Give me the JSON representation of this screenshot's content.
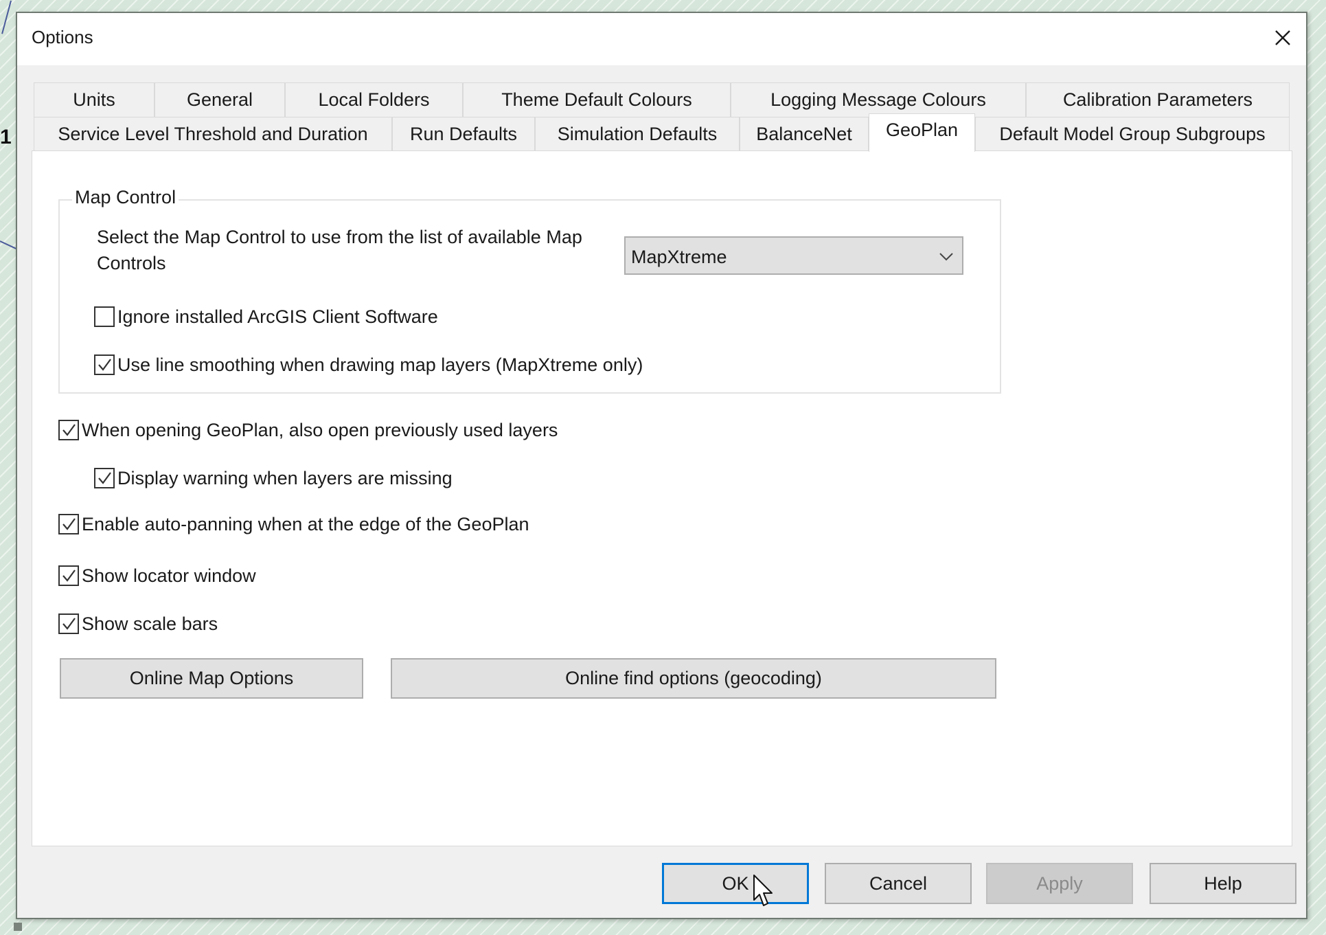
{
  "background": {
    "partial_label": "1"
  },
  "dialog": {
    "title": "Options",
    "close_icon": "close-icon",
    "tabs_row1": [
      {
        "label": "Units"
      },
      {
        "label": "General"
      },
      {
        "label": "Local Folders"
      },
      {
        "label": "Theme Default Colours"
      },
      {
        "label": "Logging Message Colours"
      },
      {
        "label": "Calibration Parameters"
      }
    ],
    "tabs_row2": [
      {
        "label": "Service Level Threshold and Duration"
      },
      {
        "label": "Run Defaults"
      },
      {
        "label": "Simulation Defaults"
      },
      {
        "label": "BalanceNet"
      },
      {
        "label": "GeoPlan",
        "selected": true
      },
      {
        "label": "Default Model Group Subgroups"
      }
    ],
    "active_tab": "GeoPlan",
    "geoplan": {
      "map_control_group": {
        "title": "Map Control",
        "select_label": "Select the Map Control to use from the list of available Map Controls",
        "select_value": "MapXtreme",
        "ignore_arcgis": {
          "label": "Ignore installed ArcGIS Client Software",
          "checked": false
        },
        "line_smoothing": {
          "label": "Use line smoothing when drawing map layers (MapXtreme only)",
          "checked": true
        }
      },
      "open_previous_layers": {
        "label": "When opening GeoPlan, also open previously used layers",
        "checked": true
      },
      "display_warning": {
        "label": "Display warning when layers are missing",
        "checked": true
      },
      "auto_panning": {
        "label": "Enable auto-panning when at the edge of the GeoPlan",
        "checked": true
      },
      "show_locator": {
        "label": "Show locator window",
        "checked": true
      },
      "show_scale_bars": {
        "label": "Show scale bars",
        "checked": true
      },
      "online_map_options_label": "Online Map Options",
      "online_find_options_label": "Online find options (geocoding)"
    },
    "footer": {
      "ok_label": "OK",
      "cancel_label": "Cancel",
      "apply_label": "Apply",
      "apply_enabled": false,
      "help_label": "Help"
    },
    "colors": {
      "focus_border": "#0078d7",
      "dialog_background": "#f0f0f0",
      "panel_background": "#ffffff"
    }
  }
}
